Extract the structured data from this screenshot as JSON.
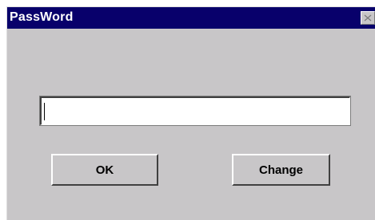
{
  "window": {
    "title": "PassWord",
    "close_icon": "close-x-icon"
  },
  "password_field": {
    "value": "",
    "placeholder": ""
  },
  "buttons": {
    "ok_label": "OK",
    "change_label": "Change"
  },
  "colors": {
    "titlebar": "#08006b",
    "window_bg": "#c8c6c8",
    "title_text": "#ffffff"
  }
}
